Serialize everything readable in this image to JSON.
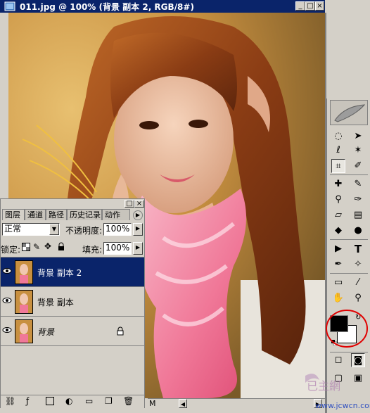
{
  "document": {
    "title": "011.jpg @ 100% (背景 副本 2, RGB/8#)",
    "minimize": "_",
    "maximize": "□",
    "close": "×",
    "status_zoom": "M"
  },
  "layers_panel": {
    "tabs": [
      "图层",
      "通道",
      "路径",
      "历史记录",
      "动作"
    ],
    "blend_mode": "正常",
    "opacity_label": "不透明度:",
    "opacity_value": "100%",
    "lock_label": "锁定:",
    "fill_label": "填充:",
    "fill_value": "100%",
    "layers": [
      {
        "name": "背景 副本 2",
        "selected": true
      },
      {
        "name": "背景 副本",
        "selected": false
      },
      {
        "name": "背景",
        "selected": false,
        "locked": true
      }
    ]
  },
  "watermark": "www.jcwcn.com",
  "colors": {
    "titlebar": "#0a246a",
    "foreground": "#000000",
    "background": "#ffffff",
    "annotation_circle": "#e00000"
  }
}
